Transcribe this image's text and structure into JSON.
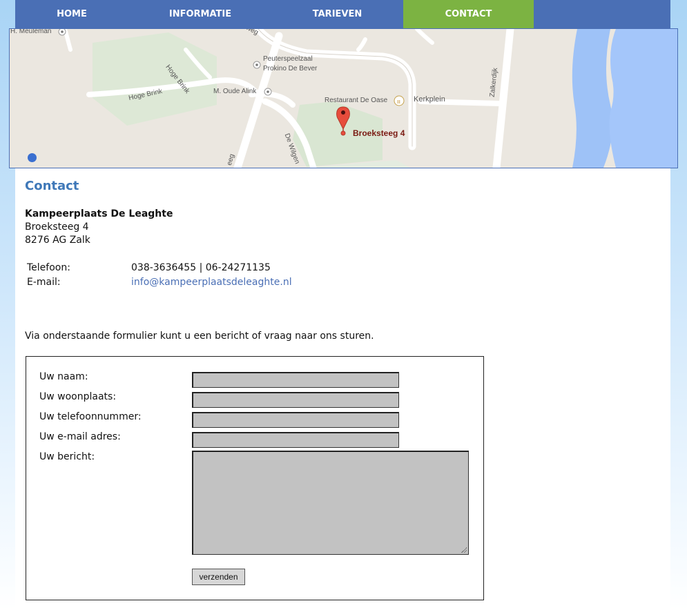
{
  "nav": {
    "items": [
      {
        "label": "HOME"
      },
      {
        "label": "INFORMATIE"
      },
      {
        "label": "TARIEVEN"
      },
      {
        "label": "CONTACT"
      }
    ],
    "active_color": "#7cb342",
    "bar_color": "#4a6fb5"
  },
  "map": {
    "labels": {
      "meuleman": "H. Meuleman",
      "enkweg": "nkweg",
      "peuterspeelzaal": "Peuterspeelzaal",
      "prokino": "Prokino De Bever",
      "hoge_brink_1": "Hoge Brink",
      "hoge_brink_2": "Hoge Brink",
      "oude_alink": "M. Oude Alink",
      "restaurant": "Restaurant De Oase",
      "kerkplein": "Kerkplein",
      "zalkerdijk": "Zalkerdijk",
      "de_wilgen": "De Wilgen",
      "steeg": "eeg",
      "marker": "Broeksteeg 4"
    }
  },
  "contact": {
    "heading": "Contact",
    "company": "Kampeerplaats De Leaghte",
    "street": "Broeksteeg 4",
    "city": "8276 AG Zalk",
    "phone_label": "Telefoon:",
    "phone_value": "038-3636455 | 06-24271135",
    "email_label": "E-mail:",
    "email_value": "info@kampeerplaatsdeleaghte.nl",
    "intro": "Via onderstaande formulier kunt u een bericht of vraag naar ons sturen."
  },
  "form": {
    "name_label": "Uw naam:",
    "city_label": "Uw woonplaats:",
    "phone_label": "Uw telefoonnummer:",
    "email_label": "Uw e-mail adres:",
    "message_label": "Uw bericht:",
    "submit_label": "verzenden"
  }
}
